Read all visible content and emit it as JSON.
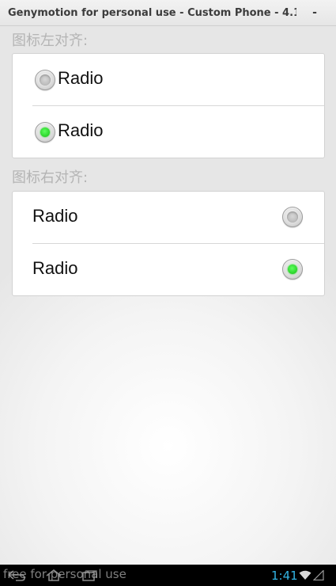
{
  "window": {
    "title": "Genymotion for personal use - Custom Phone - 4.1⋯",
    "minimize_label": "-"
  },
  "sections": [
    {
      "header": "图标左对齐:",
      "alignment": "left",
      "items": [
        {
          "label": "Radio",
          "checked": false
        },
        {
          "label": "Radio",
          "checked": true
        }
      ]
    },
    {
      "header": "图标右对齐:",
      "alignment": "right",
      "items": [
        {
          "label": "Radio",
          "checked": false
        },
        {
          "label": "Radio",
          "checked": true
        }
      ]
    }
  ],
  "statusbar": {
    "watermark": "free for personal use",
    "time": "1:41",
    "icons": [
      "back-icon",
      "home-icon",
      "recent-apps-icon",
      "wifi-icon",
      "signal-icon"
    ],
    "clock_color": "#33b5e5"
  },
  "colors": {
    "radio_checked": "#1fd11f",
    "section_header": "#b4b4b4"
  }
}
